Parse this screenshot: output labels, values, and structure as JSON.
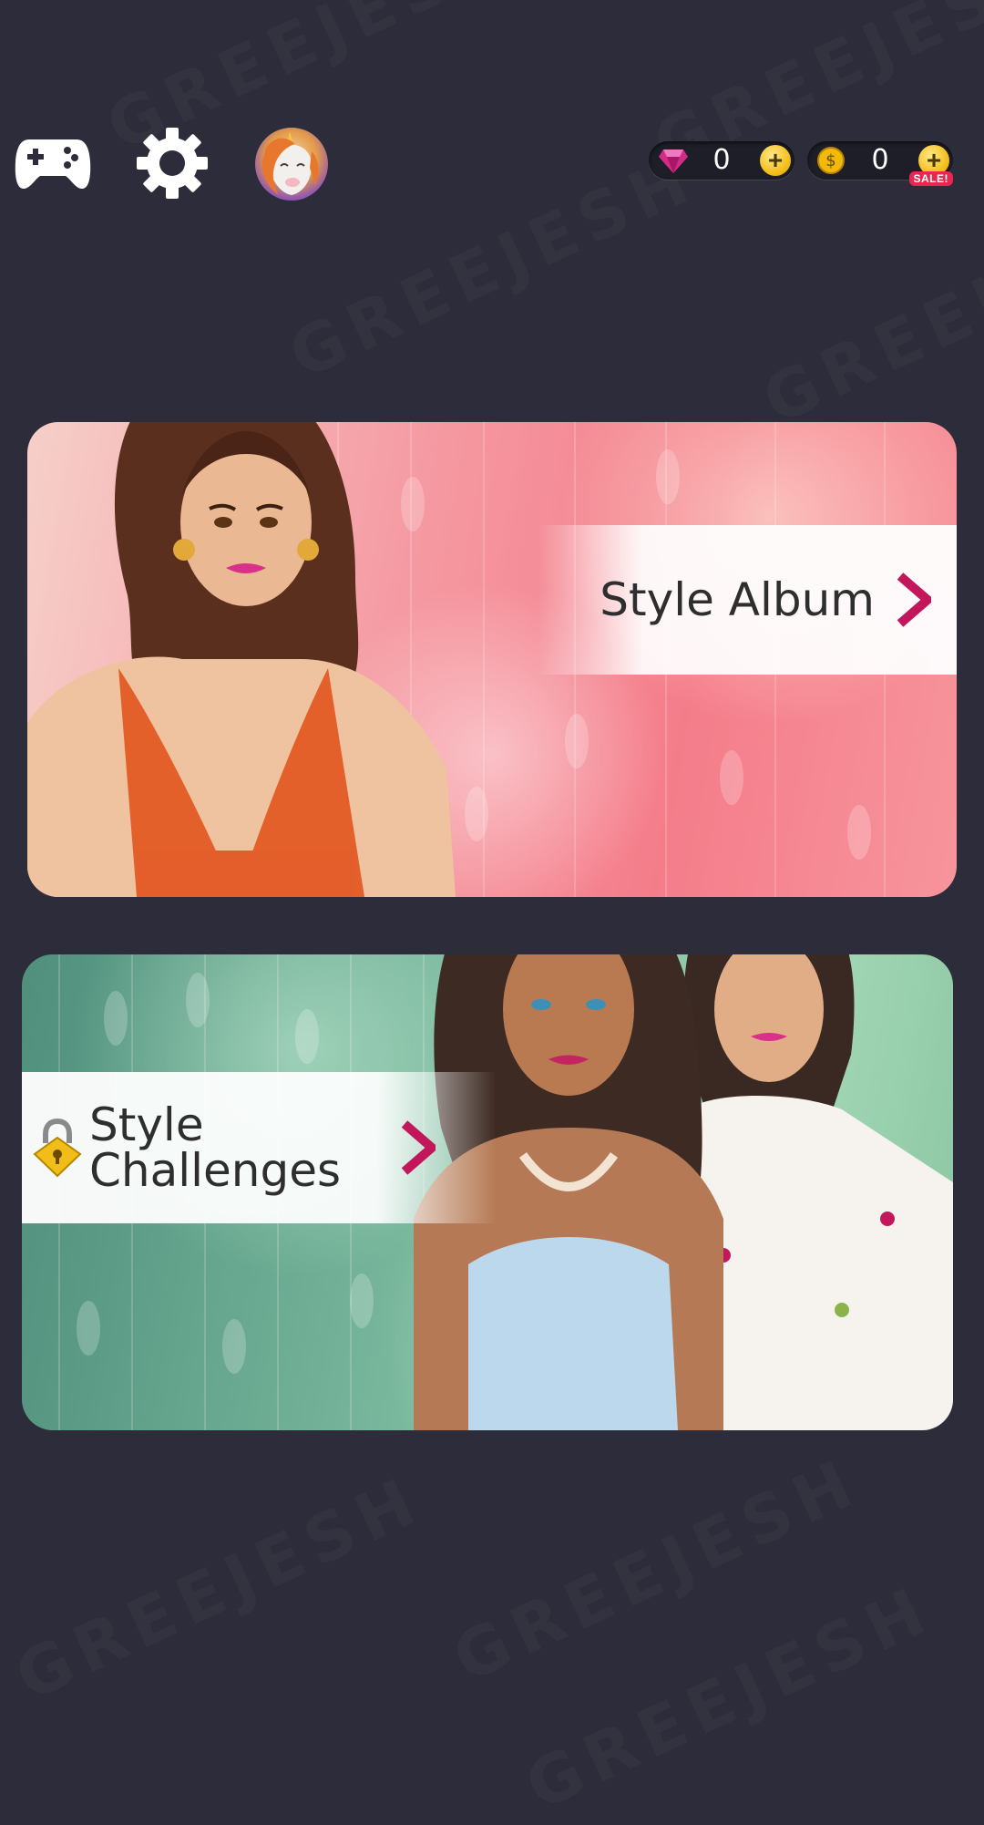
{
  "watermark": "GREEJESH",
  "header": {
    "gamepad_icon": "gamepad-icon",
    "settings_icon": "gear-icon",
    "avatar_icon": "unicorn-avatar",
    "gems": {
      "icon": "gem-icon",
      "value": "0",
      "plus": "+"
    },
    "coins": {
      "icon": "coin-icon",
      "value": "0",
      "plus": "+",
      "badge": "SALE!"
    }
  },
  "cards": {
    "album": {
      "title": "Style Album",
      "arrow": "chevron-right-icon",
      "accent": "#c2185b"
    },
    "challenges": {
      "title_line1": "Style",
      "title_line2": "Challenges",
      "lock_icon": "padlock-icon",
      "arrow": "chevron-right-icon",
      "accent": "#c2185b"
    }
  }
}
